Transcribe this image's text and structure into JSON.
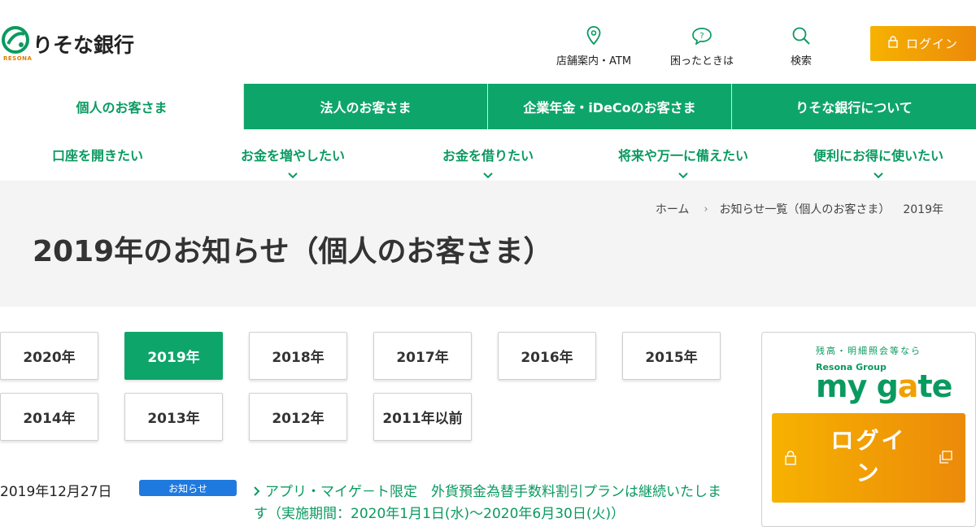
{
  "header": {
    "logo_text": "りそな銀行",
    "logo_sub": "RESONA",
    "nav": [
      {
        "label": "店舗案内・ATM",
        "icon": "map-pin-icon"
      },
      {
        "label": "困ったときは",
        "icon": "help-bubble-icon"
      },
      {
        "label": "検索",
        "icon": "search-icon"
      }
    ],
    "login_label": "ログイン"
  },
  "tabs": [
    {
      "label": "個人のお客さま",
      "active": true
    },
    {
      "label": "法人のお客さま",
      "active": false
    },
    {
      "label": "企業年金・iDeCoのお客さま",
      "active": false
    },
    {
      "label": "りそな銀行について",
      "active": false
    }
  ],
  "subnav": [
    {
      "label": "口座を開きたい",
      "has_dropdown": false
    },
    {
      "label": "お金を増やしたい",
      "has_dropdown": true
    },
    {
      "label": "お金を借りたい",
      "has_dropdown": true
    },
    {
      "label": "将来や万一に備えたい",
      "has_dropdown": true
    },
    {
      "label": "便利にお得に使いたい",
      "has_dropdown": true
    }
  ],
  "breadcrumb": {
    "home": "ホーム",
    "parent": "お知らせ一覧（個人のお客さま）",
    "current": "2019年"
  },
  "page_title": "2019年のお知らせ（個人のお客さま）",
  "years": [
    {
      "label": "2020年",
      "active": false
    },
    {
      "label": "2019年",
      "active": true
    },
    {
      "label": "2018年",
      "active": false
    },
    {
      "label": "2017年",
      "active": false
    },
    {
      "label": "2016年",
      "active": false
    },
    {
      "label": "2015年",
      "active": false
    },
    {
      "label": "2014年",
      "active": false
    },
    {
      "label": "2013年",
      "active": false
    },
    {
      "label": "2012年",
      "active": false
    },
    {
      "label": "2011年以前",
      "active": false
    }
  ],
  "news": [
    {
      "date": "2019年12月27日",
      "badge": "お知らせ",
      "title": "アプリ・マイゲ－ト限定　外貨預金為替手数料割引プランは継続いたします（実施期間：2020年1月1日(水)～2020年6月30日(火)）"
    }
  ],
  "side": {
    "tagline": "残高・明細照会等なら",
    "group": "Resona Group",
    "brand_a": "my g",
    "brand_b": "a",
    "brand_c": "te",
    "login_label": "ログイン"
  },
  "colors": {
    "green": "#0ea56b",
    "orange": "#f6b200",
    "blue_badge": "#1f7ae0"
  }
}
